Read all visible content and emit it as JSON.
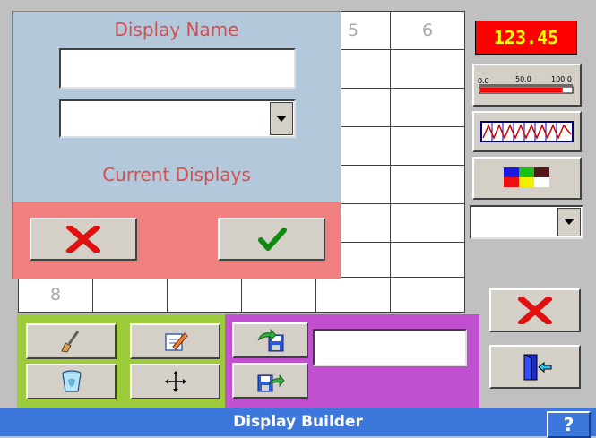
{
  "grid": {
    "header_cells": [
      "5",
      "6"
    ],
    "row_label": "8"
  },
  "dialog": {
    "title": "Display Name",
    "name_value": "",
    "selected_display": "",
    "current_displays_label": "Current Displays",
    "cancel_icon": "red-x-icon",
    "ok_icon": "green-check-icon"
  },
  "right_panel": {
    "digital_value": "123.45",
    "bar_scale": [
      "0.0",
      "50.0",
      "100.0"
    ],
    "bar_level_percent": 90,
    "trend_icon": "trend-chart-icon",
    "color_icon": "color-palette-icon",
    "combo_value": "",
    "delete_icon": "red-x-icon",
    "exit_icon": "exit-door-icon"
  },
  "tools": {
    "edit_icon": "paintbrush-icon",
    "rename_icon": "pencil-icon",
    "delete_icon": "trash-icon",
    "move_icon": "move-arrows-icon",
    "save_icon": "save-icon",
    "load_icon": "load-icon",
    "filename_value": ""
  },
  "status": {
    "title": "Display Builder",
    "help_label": "?"
  },
  "colors": {
    "dialog_bg": "#b4c8dc",
    "dialog_title": "#d05050",
    "dialog_footer": "#f08080",
    "green_panel": "#9ccc3c",
    "purple_panel": "#c050d0",
    "status_bar": "#3c78dc"
  }
}
